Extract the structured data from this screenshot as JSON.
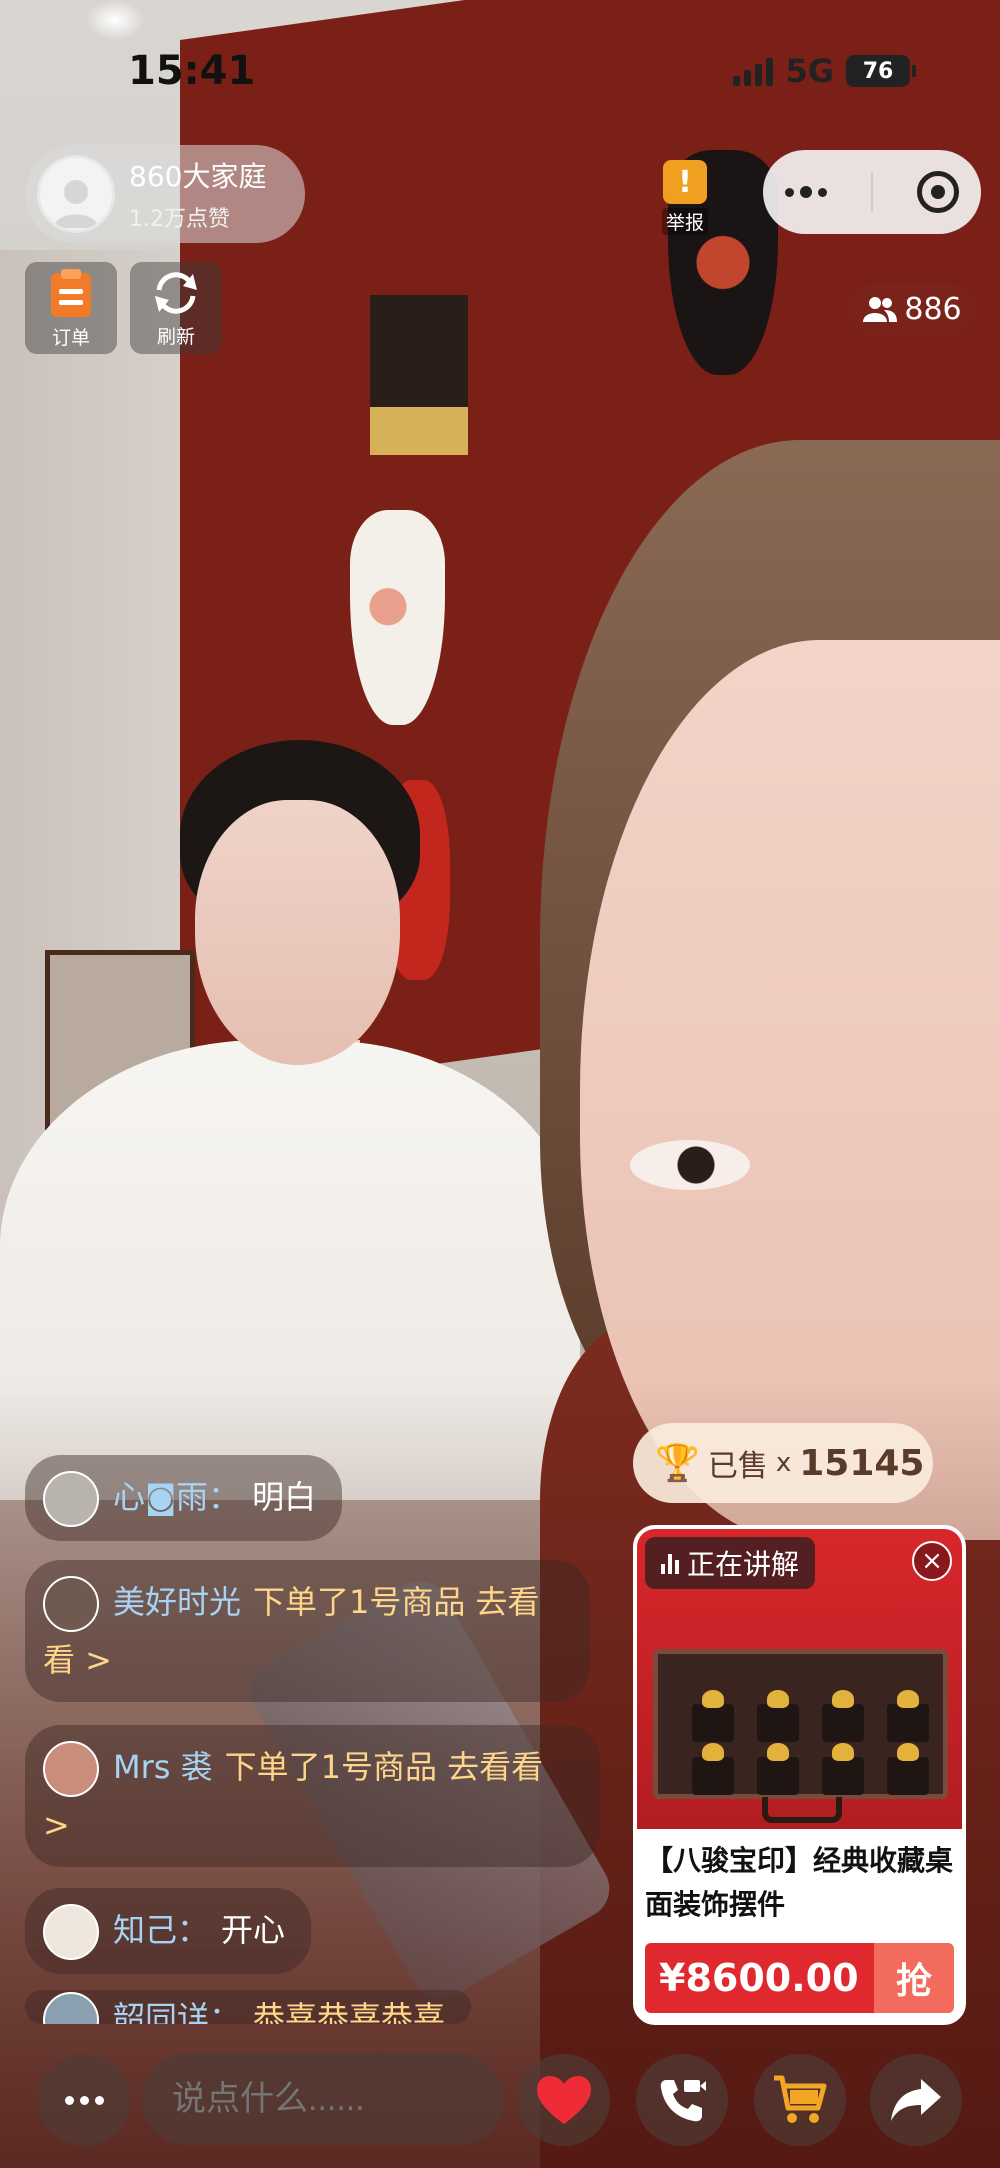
{
  "status_bar": {
    "time": "15:41",
    "network": "5G",
    "battery": "76"
  },
  "host": {
    "name": "860大家庭",
    "likes": "1.2万点赞"
  },
  "quick_actions": {
    "orders_label": "订单",
    "refresh_label": "刷新"
  },
  "top_right": {
    "report_label": "举报",
    "viewer_count": "886"
  },
  "comments": [
    {
      "user": "心◙雨：",
      "text": "明白",
      "action": ""
    },
    {
      "user": "美好时光",
      "text": "",
      "action": "下单了1号商品 去看看 >"
    },
    {
      "user": "Mrs 裘",
      "text": "",
      "action": "下单了1号商品 去看看 >"
    },
    {
      "user": "知己：",
      "text": "开心",
      "action": ""
    },
    {
      "user": "韶同详：",
      "text": "",
      "action": "恭喜恭喜恭喜"
    }
  ],
  "sold": {
    "label": "已售",
    "x": "x",
    "count": "15145"
  },
  "product": {
    "badge": "正在讲解",
    "title": "【八骏宝印】经典收藏桌面装饰摆件",
    "price": "¥8600.00",
    "buy_label": "抢"
  },
  "bottom_bar": {
    "input_placeholder": "说点什么......"
  },
  "colors": {
    "accent_red": "#e0292e",
    "gold": "#e9a41c",
    "username_blue": "#a7d3f5",
    "action_yellow": "#ffd58a"
  },
  "icons": [
    "user-icon",
    "order-icon",
    "refresh-icon",
    "report-icon",
    "more-dots-icon",
    "target-icon",
    "viewers-icon",
    "trophy-icon",
    "audio-bars-icon",
    "close-icon",
    "heart-icon",
    "video-call-icon",
    "cart-icon",
    "share-icon"
  ]
}
